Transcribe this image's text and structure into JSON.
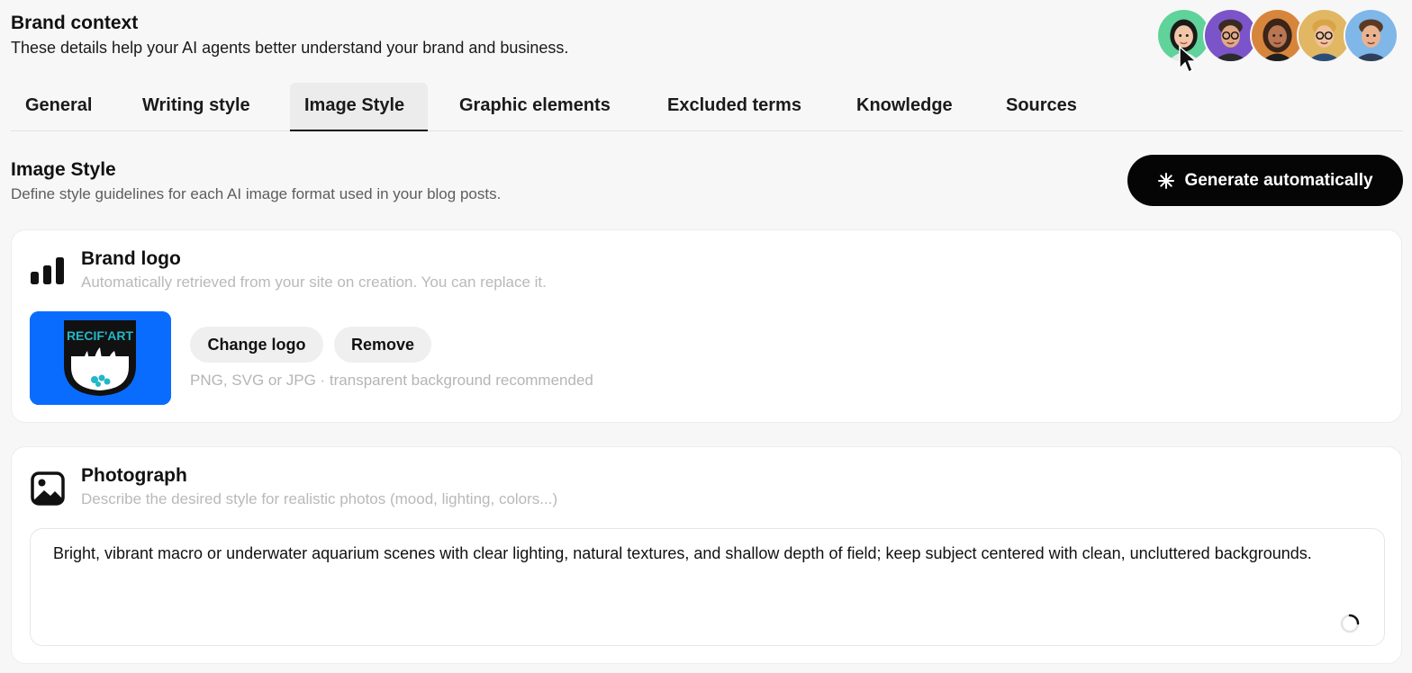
{
  "header": {
    "title": "Brand context",
    "subtitle": "These details help your AI agents better understand your brand and business."
  },
  "avatars": [
    {
      "name": "agent-avatar-1",
      "bg": "#5fd39a"
    },
    {
      "name": "agent-avatar-2",
      "bg": "#7b54c9"
    },
    {
      "name": "agent-avatar-3",
      "bg": "#d8853c"
    },
    {
      "name": "agent-avatar-4",
      "bg": "#e2b763"
    },
    {
      "name": "agent-avatar-5",
      "bg": "#7fb7e8"
    }
  ],
  "tabs": [
    {
      "label": "General",
      "active": false
    },
    {
      "label": "Writing style",
      "active": false
    },
    {
      "label": "Image Style",
      "active": true
    },
    {
      "label": "Graphic elements",
      "active": false
    },
    {
      "label": "Excluded terms",
      "active": false
    },
    {
      "label": "Knowledge",
      "active": false
    },
    {
      "label": "Sources",
      "active": false
    }
  ],
  "section": {
    "title": "Image Style",
    "subtitle": "Define style guidelines for each AI image format used in your blog posts.",
    "generate_label": "Generate automatically"
  },
  "brand_logo": {
    "title": "Brand logo",
    "subtitle": "Automatically retrieved from your site on creation. You can replace it.",
    "logo_text": "RECIF'ART",
    "change_label": "Change logo",
    "remove_label": "Remove",
    "hint": "PNG, SVG or JPG · transparent background recommended",
    "logo_bg_color": "#0a6cff"
  },
  "photograph": {
    "title": "Photograph",
    "subtitle": "Describe the desired style for realistic photos (mood, lighting, colors...)",
    "value": "Bright, vibrant macro or underwater aquarium scenes with clear lighting, natural textures, and shallow depth of field; keep subject centered with clean, uncluttered backgrounds."
  },
  "colors": {
    "accent": "#050505",
    "background": "#f7f7f7"
  }
}
